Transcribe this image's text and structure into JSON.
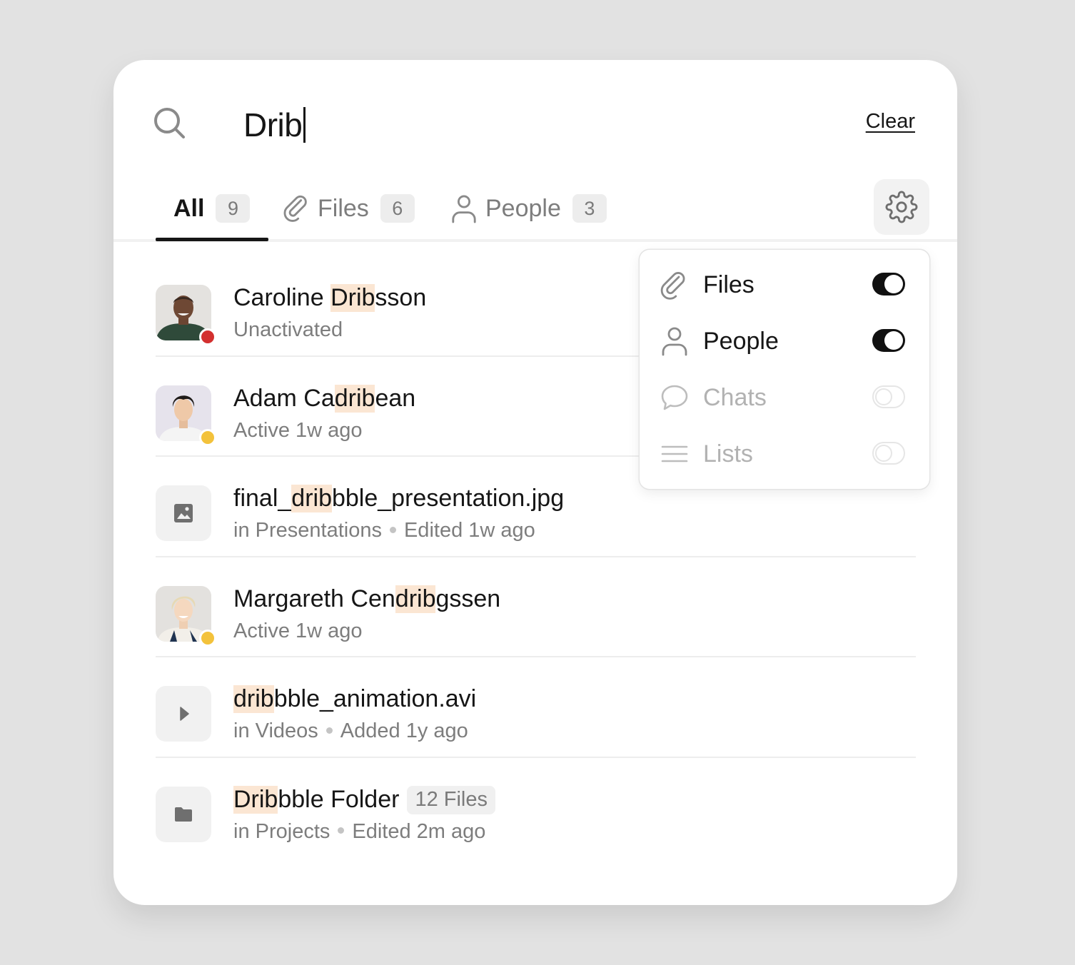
{
  "search": {
    "query": "Drib",
    "clear_label": "Clear"
  },
  "tabs": [
    {
      "label": "All",
      "count": "9",
      "icon": "none",
      "active": true
    },
    {
      "label": "Files",
      "count": "6",
      "icon": "paperclip-icon",
      "active": false
    },
    {
      "label": "People",
      "count": "3",
      "icon": "person-icon",
      "active": false
    }
  ],
  "settings": {
    "icon": "gear-icon"
  },
  "results": [
    {
      "kind": "person",
      "title_parts": [
        "Caroline ",
        "Drib",
        "sson"
      ],
      "subtitle": "Unactivated",
      "status": "red"
    },
    {
      "kind": "person",
      "title_parts": [
        "Adam Ca",
        "drib",
        "ean"
      ],
      "subtitle": "Active 1w ago",
      "status": "yellow"
    },
    {
      "kind": "file",
      "icon": "image-icon",
      "title_parts": [
        "final_",
        "drib",
        "bble_presentation.jpg"
      ],
      "location": "in Presentations",
      "meta": "Edited 1w ago"
    },
    {
      "kind": "person",
      "title_parts": [
        "Margareth Cen",
        "drib",
        "gssen"
      ],
      "subtitle": "Active 1w ago",
      "status": "yellow"
    },
    {
      "kind": "file",
      "icon": "play-icon",
      "title_parts": [
        "",
        "drib",
        "bble_animation.avi"
      ],
      "location": "in Videos",
      "meta": "Added 1y ago"
    },
    {
      "kind": "folder",
      "icon": "folder-icon",
      "title_parts": [
        "",
        "Drib",
        "bble Folder"
      ],
      "badge": "12 Files",
      "location": "in Projects",
      "meta": "Edited 2m ago"
    }
  ],
  "filters": [
    {
      "label": "Files",
      "icon": "paperclip-icon",
      "enabled": true
    },
    {
      "label": "People",
      "icon": "person-icon",
      "enabled": true
    },
    {
      "label": "Chats",
      "icon": "chat-bubble-icon",
      "enabled": false
    },
    {
      "label": "Lists",
      "icon": "list-icon",
      "enabled": false
    }
  ],
  "colors": {
    "highlight": "#fbe6d3",
    "status_red": "#d3302f",
    "status_yellow": "#f3c23b",
    "toggle_on": "#111111"
  }
}
